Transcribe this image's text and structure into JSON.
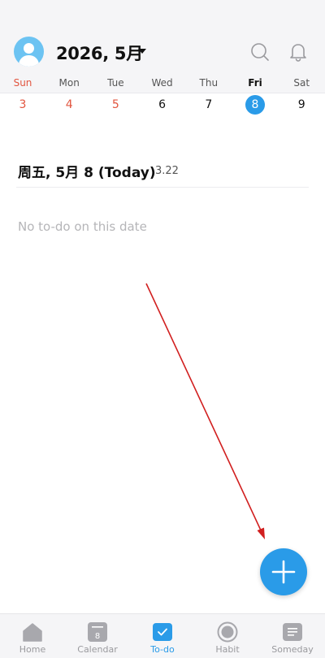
{
  "header": {
    "month_title": "2026, 5月"
  },
  "weekdays": [
    {
      "label": "Sun",
      "style": "sun"
    },
    {
      "label": "Mon",
      "style": ""
    },
    {
      "label": "Tue",
      "style": ""
    },
    {
      "label": "Wed",
      "style": ""
    },
    {
      "label": "Thu",
      "style": ""
    },
    {
      "label": "Fri",
      "style": "today"
    },
    {
      "label": "Sat",
      "style": ""
    }
  ],
  "dates": [
    {
      "label": "3",
      "style": "holiday"
    },
    {
      "label": "4",
      "style": "holiday"
    },
    {
      "label": "5",
      "style": "holiday"
    },
    {
      "label": "6",
      "style": ""
    },
    {
      "label": "7",
      "style": ""
    },
    {
      "label": "8",
      "style": "selected"
    },
    {
      "label": "9",
      "style": ""
    }
  ],
  "day": {
    "heading": "周五, 5月 8 (Today)",
    "lunar": "3.22",
    "empty_text": "No to-do on this date"
  },
  "nav": {
    "items": [
      {
        "label": "Home",
        "icon": "home-icon"
      },
      {
        "label": "Calendar",
        "icon": "calendar-icon",
        "badge": "8"
      },
      {
        "label": "To-do",
        "icon": "todo-check-icon"
      },
      {
        "label": "Habit",
        "icon": "habit-circle-icon"
      },
      {
        "label": "Someday",
        "icon": "someday-note-icon"
      }
    ],
    "active_index": 2
  },
  "colors": {
    "accent": "#2a9be8",
    "holiday": "#e2553f",
    "annotation_arrow": "#d11f1f"
  }
}
